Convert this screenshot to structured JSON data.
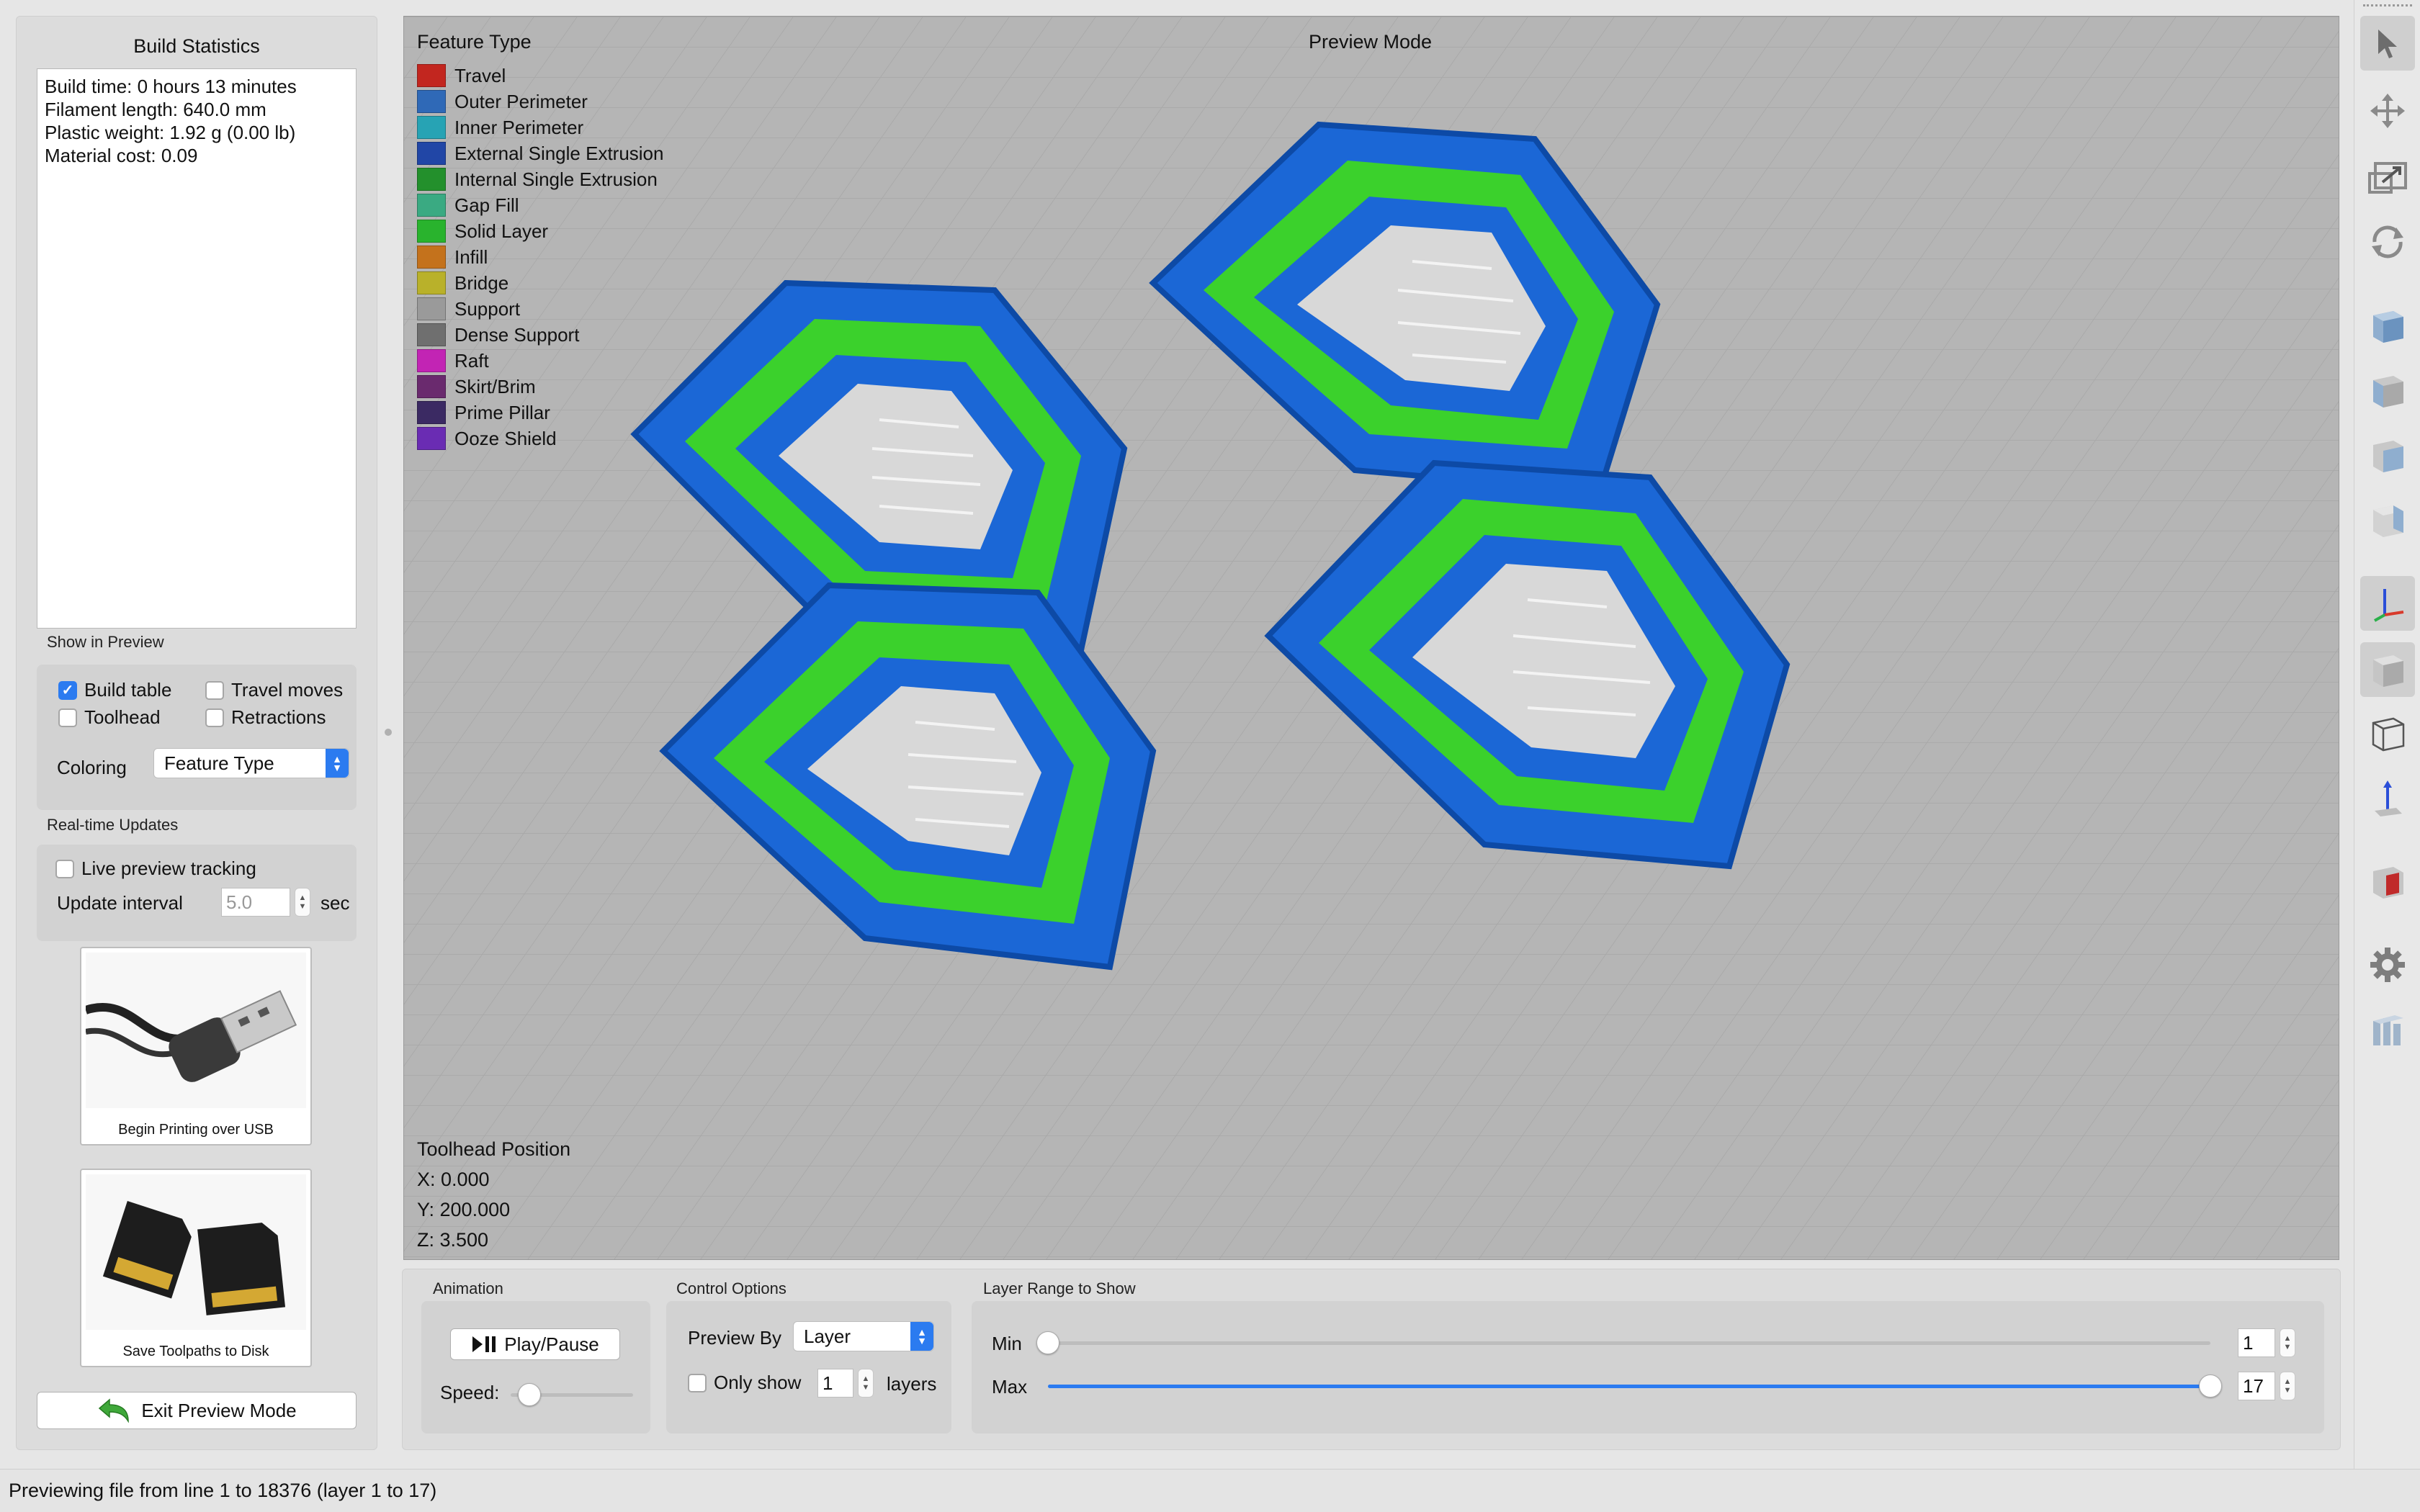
{
  "left_panel": {
    "title": "Build Statistics",
    "stats": [
      "Build time: 0 hours 13 minutes",
      "Filament length: 640.0 mm",
      "Plastic weight: 1.92 g (0.00 lb)",
      "Material cost: 0.09"
    ],
    "show_in_preview": {
      "label": "Show in Preview",
      "build_table": {
        "label": "Build table",
        "checked": true
      },
      "travel_moves": {
        "label": "Travel moves",
        "checked": false
      },
      "toolhead": {
        "label": "Toolhead",
        "checked": false
      },
      "retractions": {
        "label": "Retractions",
        "checked": false
      },
      "coloring_label": "Coloring",
      "coloring_value": "Feature Type"
    },
    "realtime": {
      "label": "Real-time Updates",
      "live_tracking": {
        "label": "Live preview tracking",
        "checked": false
      },
      "interval_label": "Update interval",
      "interval_value": "5.0",
      "interval_unit": "sec"
    },
    "usb_tile": {
      "label": "Begin Printing over USB",
      "icon": "usb-cable-icon"
    },
    "disk_tile": {
      "label": "Save Toolpaths to Disk",
      "icon": "sd-card-icon"
    },
    "exit_button": "Exit Preview Mode"
  },
  "viewport": {
    "mode_title": "Preview Mode",
    "legend_title": "Feature Type",
    "legend": [
      {
        "label": "Travel",
        "color": "#c2261f"
      },
      {
        "label": "Outer Perimeter",
        "color": "#2f69b7"
      },
      {
        "label": "Inner Perimeter",
        "color": "#27a3b4"
      },
      {
        "label": "External Single Extrusion",
        "color": "#2146a6"
      },
      {
        "label": "Internal Single Extrusion",
        "color": "#23902c"
      },
      {
        "label": "Gap Fill",
        "color": "#3aaa82"
      },
      {
        "label": "Solid Layer",
        "color": "#29b32d"
      },
      {
        "label": "Infill",
        "color": "#c4721c"
      },
      {
        "label": "Bridge",
        "color": "#b9b12a"
      },
      {
        "label": "Support",
        "color": "#9a9a9a"
      },
      {
        "label": "Dense Support",
        "color": "#6f6f6f"
      },
      {
        "label": "Raft",
        "color": "#c224b4"
      },
      {
        "label": "Skirt/Brim",
        "color": "#6a2a6e"
      },
      {
        "label": "Prime Pillar",
        "color": "#3b2a63"
      },
      {
        "label": "Ooze Shield",
        "color": "#6a2cb3"
      }
    ],
    "toolhead": {
      "title": "Toolhead Position",
      "x": "X: 0.000",
      "y": "Y: 200.000",
      "z": "Z: 3.500"
    }
  },
  "animation": {
    "label": "Animation",
    "play_label": "Play/Pause",
    "speed_label": "Speed:",
    "speed_fraction": 0.15
  },
  "control_options": {
    "label": "Control Options",
    "preview_by_label": "Preview By",
    "preview_by_value": "Layer",
    "only_show_label": "Only show",
    "only_show_value": "1",
    "layers_unit": "layers",
    "only_show_checked": false
  },
  "layer_range": {
    "label": "Layer Range to Show",
    "min_label": "Min",
    "max_label": "Max",
    "min_value": "1",
    "max_value": "17",
    "total_layers": 17
  },
  "toolbar": {
    "tools": [
      "select-arrow-icon",
      "move-icon",
      "scale-icon",
      "rotate-icon",
      "view-iso-icon",
      "view-front-icon",
      "view-left-icon",
      "view-right-icon",
      "axes-icon",
      "solid-view-icon",
      "wireframe-icon",
      "z-axis-icon",
      "section-view-icon",
      "settings-gear-icon",
      "layers-columns-icon"
    ]
  },
  "status_bar": {
    "text": "Previewing file from line 1 to 18376 (layer 1 to 17)"
  }
}
